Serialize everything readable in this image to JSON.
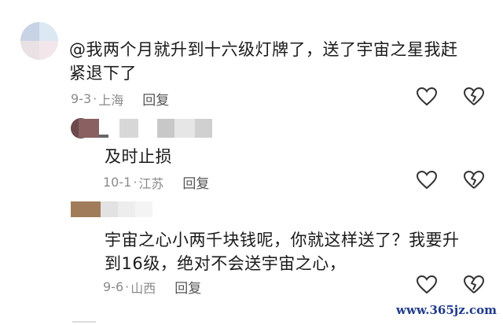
{
  "comments": [
    {
      "text_line1": "@我两个月就升到十六级灯牌了，送了宇宙之星我赶",
      "text_line2": "紧退下了",
      "date": "9-3",
      "location": "上海",
      "reply_label": "回复"
    },
    {
      "text_line1": "及时止损",
      "date": "10-1",
      "location": "江苏",
      "reply_label": "回复"
    },
    {
      "text_line1": "宇宙之心小两千块钱呢，你就这样送了？我要升",
      "text_line2": "到16级，绝对不会送宇宙之心，",
      "date": "9-6",
      "location": "山西",
      "reply_label": "回复"
    }
  ],
  "icons": {
    "like": "heart-outline-icon",
    "dislike": "broken-heart-icon"
  },
  "separator": "·",
  "watermark": "www.365jz.com"
}
